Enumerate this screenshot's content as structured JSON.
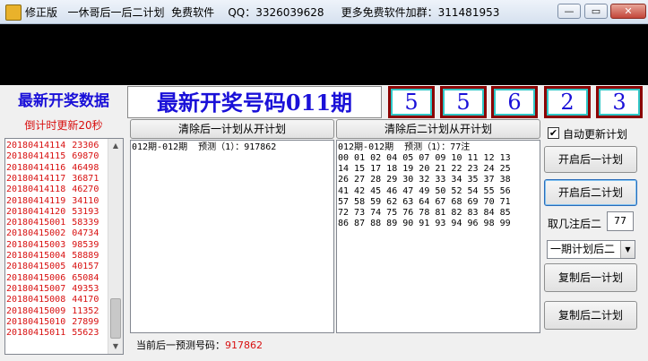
{
  "window": {
    "title": "修正版   一休哥后一后二计划  免费软件    QQ：3326039628     更多免费软件加群：311481953",
    "minimize_glyph": "—",
    "maximize_glyph": "▭",
    "close_glyph": "✕"
  },
  "header": {
    "latest_label": "最新开奖数据",
    "countdown": "倒计时更新20秒",
    "headline": "最新开奖号码011期",
    "digits": [
      "5",
      "5",
      "6",
      "2",
      "3"
    ]
  },
  "history": [
    {
      "issue": "20180414114",
      "number": "23306"
    },
    {
      "issue": "20180414115",
      "number": "69870"
    },
    {
      "issue": "20180414116",
      "number": "46498"
    },
    {
      "issue": "20180414117",
      "number": "36871"
    },
    {
      "issue": "20180414118",
      "number": "46270"
    },
    {
      "issue": "20180414119",
      "number": "34110"
    },
    {
      "issue": "20180414120",
      "number": "53193"
    },
    {
      "issue": "20180415001",
      "number": "58339"
    },
    {
      "issue": "20180415002",
      "number": "04734"
    },
    {
      "issue": "20180415003",
      "number": "98539"
    },
    {
      "issue": "20180415004",
      "number": "58889"
    },
    {
      "issue": "20180415005",
      "number": "40157"
    },
    {
      "issue": "20180415006",
      "number": "65084"
    },
    {
      "issue": "20180415007",
      "number": "49353"
    },
    {
      "issue": "20180415008",
      "number": "44170"
    },
    {
      "issue": "20180415009",
      "number": "11352"
    },
    {
      "issue": "20180415010",
      "number": "27899"
    },
    {
      "issue": "20180415011",
      "number": "55623"
    }
  ],
  "plan1": {
    "clear_button": "清除后一计划从开计划",
    "text": "012期-012期  预测（1）：917862"
  },
  "plan2": {
    "clear_button": "清除后二计划从开计划",
    "header": "012期-012期  预测（1）：77注",
    "lines": [
      "00 01 02 04 05 07 09 10 11 12 13",
      "14 15 17 18 19 20 21 22 23 24 25",
      "26 27 28 29 30 32 33 34 35 37 38",
      "41 42 45 46 47 49 50 52 54 55 56",
      "57 58 59 62 63 64 67 68 69 70 71",
      "72 73 74 75 76 78 81 82 83 84 85",
      "86 87 88 89 90 91 93 94 96 98 99"
    ]
  },
  "controls": {
    "auto_update_label": "自动更新计划",
    "auto_update_checked": true,
    "check_glyph": "✔",
    "start_plan1": "开启后一计划",
    "start_plan2": "开启后二计划",
    "take_label": "取几注后二",
    "take_value": "77",
    "period_select": "一期计划后二",
    "copy_plan1": "复制后一计划",
    "copy_plan2": "复制后二计划"
  },
  "status": {
    "label": "当前后一预测号码：",
    "value": "917862"
  },
  "scroll_arrows": {
    "up": "▲",
    "down": "▼",
    "dropdown": "▼"
  }
}
